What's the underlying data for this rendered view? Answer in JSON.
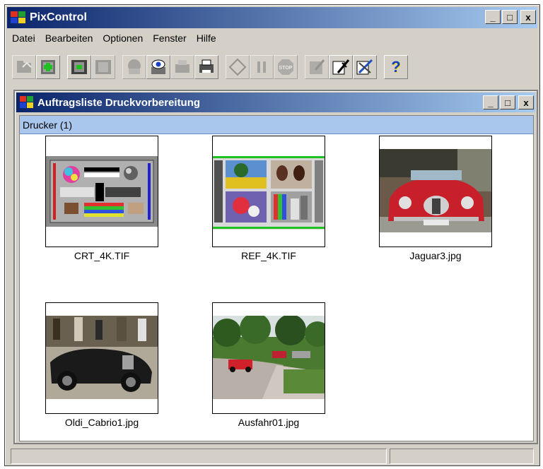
{
  "window": {
    "title": "PixControl",
    "btn_min": "_",
    "btn_max": "□",
    "btn_close": "x"
  },
  "menu": [
    "Datei",
    "Bearbeiten",
    "Optionen",
    "Fenster",
    "Hilfe"
  ],
  "toolbar": {
    "buttons": [
      {
        "icon": "import-folder-icon"
      },
      {
        "icon": "add-image-icon"
      },
      {
        "icon": "filmstrip-green-icon"
      },
      {
        "icon": "filmstrip-icon"
      },
      {
        "icon": "printer-settings-icon"
      },
      {
        "icon": "preview-eye-icon"
      },
      {
        "icon": "printer-icon"
      },
      {
        "icon": "print-queue-icon"
      },
      {
        "icon": "start-icon"
      },
      {
        "icon": "pause-icon"
      },
      {
        "icon": "stop-icon"
      },
      {
        "icon": "edit-icon"
      },
      {
        "icon": "tools-icon"
      },
      {
        "icon": "settings-wrench-icon"
      },
      {
        "icon": "help-icon"
      }
    ],
    "help_glyph": "?",
    "stop_text": "STOP"
  },
  "child_window": {
    "title": "Auftragsliste Druckvorbereitung",
    "group_header": "Drucker (1)"
  },
  "thumbnails": [
    {
      "label": "CRT_4K.TIF"
    },
    {
      "label": "REF_4K.TIF"
    },
    {
      "label": "Jaguar3.jpg"
    },
    {
      "label": "Oldi_Cabrio1.jpg"
    },
    {
      "label": "Ausfahr01.jpg"
    }
  ],
  "colors": {
    "title_gradient_start": "#0a246a",
    "title_gradient_end": "#a6caf0",
    "group_header_bg": "#a9c6ec",
    "window_bg": "#d4d0c8"
  }
}
